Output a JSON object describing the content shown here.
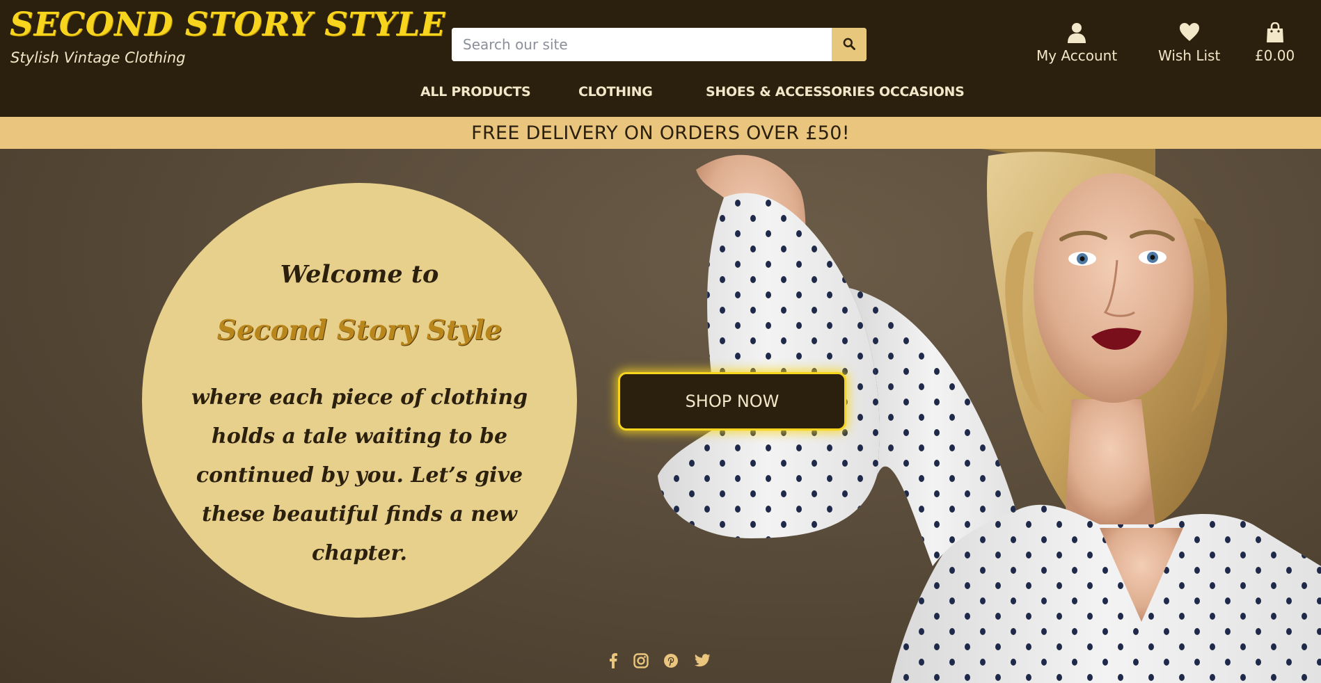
{
  "brand": {
    "name": "SECOND STORY STYLE",
    "tagline": "Stylish Vintage Clothing"
  },
  "search": {
    "placeholder": "Search our site",
    "button_icon": "search-icon"
  },
  "header_icons": [
    {
      "icon": "user-icon",
      "label": "My Account"
    },
    {
      "icon": "heart-icon",
      "label": "Wish List"
    },
    {
      "icon": "shopping-bag-icon",
      "label": "£0.00"
    }
  ],
  "nav": [
    {
      "label": "ALL PRODUCTS"
    },
    {
      "label": "CLOTHING"
    },
    {
      "label": "SHOES & ACCESSORIES"
    },
    {
      "label": "OCCASIONS"
    }
  ],
  "banner": {
    "text": "FREE DELIVERY ON ORDERS OVER £50!"
  },
  "hero": {
    "welcome": "Welcome to",
    "brand_name": "Second Story Style",
    "message": "where each piece of clothing holds a tale waiting to be continued by you. Let’s give these beautiful finds a new chapter.",
    "cta": "SHOP NOW"
  },
  "social": [
    {
      "icon": "facebook-icon"
    },
    {
      "icon": "instagram-icon"
    },
    {
      "icon": "pinterest-icon"
    },
    {
      "icon": "twitter-icon"
    }
  ],
  "colors": {
    "header_bg": "#2b1f0e",
    "brand_yellow": "#f7d51e",
    "banner_bg": "#e9c57e",
    "circle_bg": "#e7cf8c",
    "cream_text": "#f3e7c9",
    "gold_heading": "#b8861a"
  }
}
